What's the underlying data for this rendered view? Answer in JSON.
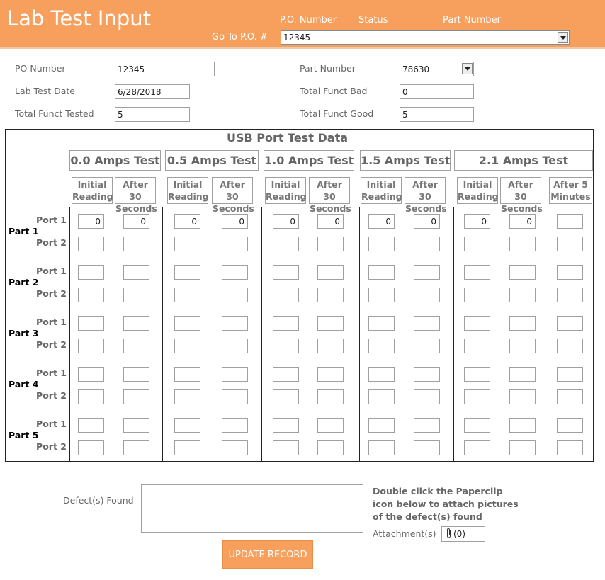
{
  "header": {
    "title": "Lab Test Input",
    "columns": [
      "P.O. Number",
      "Status",
      "Part Number"
    ],
    "goto_label": "Go To P.O. #",
    "goto_value": "12345",
    "bg_color": "#f7a05e"
  },
  "form": {
    "po_number_label": "PO Number",
    "po_number_value": "12345",
    "lab_test_date_label": "Lab Test Date",
    "lab_test_date_value": "6/28/2018",
    "total_funct_tested_label": "Total Funct Tested",
    "total_funct_tested_value": "5",
    "part_number_label": "Part Number",
    "part_number_value": "78630",
    "total_funct_bad_label": "Total Funct Bad",
    "total_funct_bad_value": "0",
    "total_funct_good_label": "Total Funct Good",
    "total_funct_good_value": "5"
  },
  "grid": {
    "title": "USB Port Test Data",
    "amps_groups": [
      {
        "label": "0.0 Amps Test",
        "cols": [
          "Initial Reading",
          "After 30 Seconds"
        ]
      },
      {
        "label": "0.5 Amps Test",
        "cols": [
          "Initial Reading",
          "After 30 Seconds"
        ]
      },
      {
        "label": "1.0 Amps Test",
        "cols": [
          "Initial Reading",
          "After 30 Seconds"
        ]
      },
      {
        "label": "1.5 Amps Test",
        "cols": [
          "Initial Reading",
          "After 30 Seconds"
        ]
      },
      {
        "label": "2.1 Amps Test",
        "cols": [
          "Initial Reading",
          "After 30 Seconds",
          "After 5 Minutes"
        ]
      }
    ],
    "parts": [
      {
        "label": "Part 1",
        "ports": [
          {
            "label": "Port 1",
            "values": [
              "0",
              "0",
              "0",
              "0",
              "0",
              "0",
              "0",
              "0",
              "0",
              "0",
              ""
            ]
          },
          {
            "label": "Port 2",
            "values": [
              "",
              "",
              "",
              "",
              "",
              "",
              "",
              "",
              "",
              "",
              ""
            ]
          }
        ]
      },
      {
        "label": "Part 2",
        "ports": [
          {
            "label": "Port 1",
            "values": [
              "",
              "",
              "",
              "",
              "",
              "",
              "",
              "",
              "",
              "",
              ""
            ]
          },
          {
            "label": "Port 2",
            "values": [
              "",
              "",
              "",
              "",
              "",
              "",
              "",
              "",
              "",
              "",
              ""
            ]
          }
        ]
      },
      {
        "label": "Part 3",
        "ports": [
          {
            "label": "Port 1",
            "values": [
              "",
              "",
              "",
              "",
              "",
              "",
              "",
              "",
              "",
              "",
              ""
            ]
          },
          {
            "label": "Port 2",
            "values": [
              "",
              "",
              "",
              "",
              "",
              "",
              "",
              "",
              "",
              "",
              ""
            ]
          }
        ]
      },
      {
        "label": "Part 4",
        "ports": [
          {
            "label": "Port 1",
            "values": [
              "",
              "",
              "",
              "",
              "",
              "",
              "",
              "",
              "",
              "",
              ""
            ]
          },
          {
            "label": "Port 2",
            "values": [
              "",
              "",
              "",
              "",
              "",
              "",
              "",
              "",
              "",
              "",
              ""
            ]
          }
        ]
      },
      {
        "label": "Part 5",
        "ports": [
          {
            "label": "Port 1",
            "values": [
              "",
              "",
              "",
              "",
              "",
              "",
              "",
              "",
              "",
              "",
              ""
            ]
          },
          {
            "label": "Port 2",
            "values": [
              "",
              "",
              "",
              "",
              "",
              "",
              "",
              "",
              "",
              "",
              ""
            ]
          }
        ]
      }
    ]
  },
  "bottom": {
    "defects_label": "Defect(s) Found",
    "defects_value": "",
    "instructions": "Double click the Paperclip icon below to attach pictures of the defect(s) found",
    "attachments_label": "Attachment(s)",
    "attachments_count": "(0)",
    "attachment_icon": "paperclip-icon",
    "update_button": "UPDATE RECORD"
  }
}
